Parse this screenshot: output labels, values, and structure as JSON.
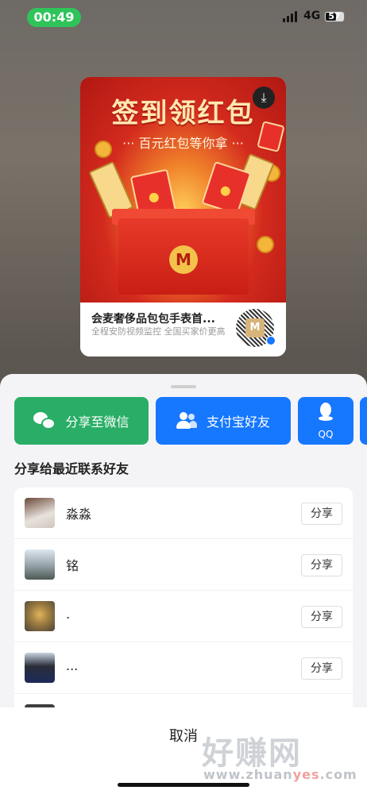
{
  "status_bar": {
    "time": "00:49",
    "network": "4G",
    "battery": "57"
  },
  "poster": {
    "title": "签到领红包",
    "subtitle": "··· 百元红包等你拿 ···",
    "logo_letter": "M",
    "shop_name": "会麦奢侈品包包手表首...",
    "description": "全程安防视频监控 全国买家价更高",
    "icons": {
      "download": "download-icon",
      "qr": "qr-code"
    }
  },
  "share": {
    "channels": [
      {
        "label": "分享至微信",
        "icon": "wechat-icon",
        "color": "#2aae67"
      },
      {
        "label": "支付宝好友",
        "icon": "contacts-icon",
        "color": "#1677ff"
      },
      {
        "label": "QQ",
        "icon": "qq-icon",
        "color": "#1677ff"
      }
    ],
    "section_title": "分享给最近联系好友",
    "share_label": "分享",
    "contacts": [
      {
        "name": "淼淼"
      },
      {
        "name": "铭"
      },
      {
        "name": "."
      },
      {
        "name": "..."
      }
    ],
    "cancel": "取消"
  },
  "watermark": {
    "text": "好赚网",
    "url_prefix": "www.zhuan",
    "url_accent": "yes",
    "url_suffix": ".com"
  }
}
